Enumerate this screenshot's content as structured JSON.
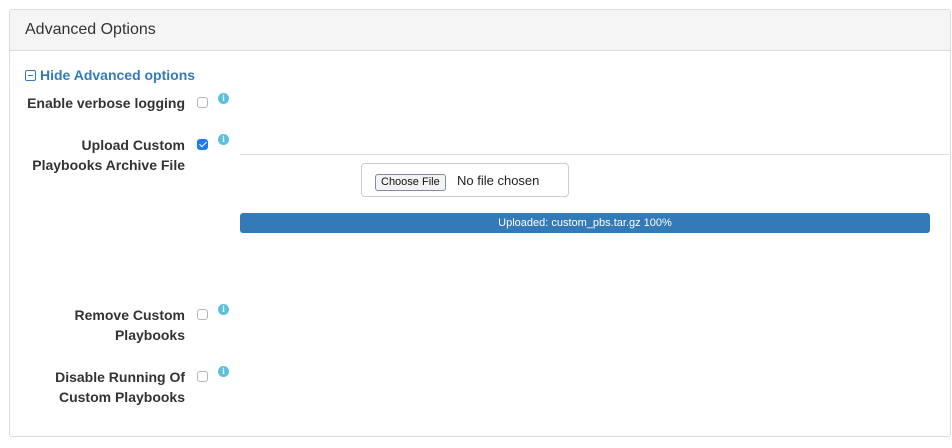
{
  "panel": {
    "title": "Advanced Options",
    "toggle_label": "Hide Advanced options"
  },
  "options": [
    {
      "label_lines": [
        "Enable verbose logging"
      ],
      "checked": false,
      "info_icon": "info-circle-icon"
    },
    {
      "label_lines": [
        "Upload Custom",
        "Playbooks Archive File"
      ],
      "checked": true,
      "info_icon": "info-circle-icon"
    },
    {
      "label_lines": [
        "Remove Custom",
        "Playbooks"
      ],
      "checked": false,
      "info_icon": "info-circle-icon"
    },
    {
      "label_lines": [
        "Disable Running Of",
        "Custom Playbooks"
      ],
      "checked": false,
      "info_icon": "info-circle-icon"
    }
  ],
  "upload": {
    "choose_button": "Choose File",
    "file_status": "No file chosen",
    "progress_text": "Uploaded: custom_pbs.tar.gz 100%",
    "progress_percent": 100
  },
  "colors": {
    "accent": "#337ab7",
    "info": "#5bc0de",
    "checkbox_checked": "#1f7bf2"
  }
}
